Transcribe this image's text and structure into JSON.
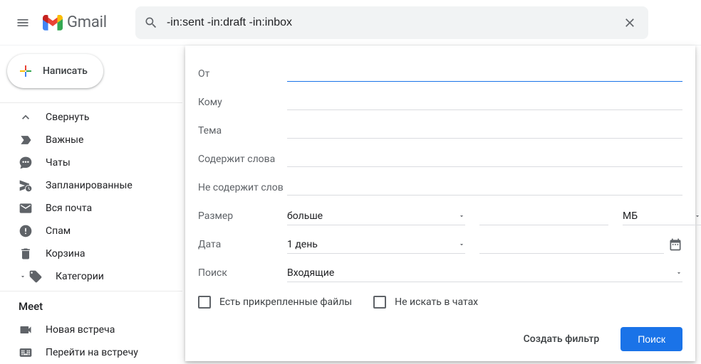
{
  "header": {
    "logo_text": "Gmail",
    "search_value": "-in:sent -in:draft -in:inbox"
  },
  "sidebar": {
    "compose_label": "Написать",
    "items": [
      {
        "label": "Свернуть",
        "icon": "expand-less-icon"
      },
      {
        "label": "Важные",
        "icon": "label-important-icon"
      },
      {
        "label": "Чаты",
        "icon": "chat-icon"
      },
      {
        "label": "Запланированные",
        "icon": "schedule-send-icon"
      },
      {
        "label": "Вся почта",
        "icon": "all-mail-icon"
      },
      {
        "label": "Спам",
        "icon": "spam-icon"
      },
      {
        "label": "Корзина",
        "icon": "trash-icon"
      },
      {
        "label": "Категории",
        "icon": "category-icon"
      }
    ],
    "meet_header": "Meet",
    "meet_items": [
      {
        "label": "Новая встреча",
        "icon": "videocam-icon"
      },
      {
        "label": "Перейти на встречу",
        "icon": "keyboard-icon"
      }
    ]
  },
  "adv": {
    "from_label": "От",
    "to_label": "Кому",
    "subject_label": "Тема",
    "has_words_label": "Содержит слова",
    "not_words_label": "Не содержит слов",
    "size_label": "Размер",
    "size_op": "больше",
    "size_unit": "МБ",
    "date_label": "Дата",
    "date_within": "1 день",
    "search_in_label": "Поиск",
    "search_in_value": "Входящие",
    "cbx_attach": "Есть прикрепленные файлы",
    "cbx_nochats": "Не искать в чатах",
    "create_filter": "Создать фильтр",
    "search_btn": "Поиск"
  }
}
